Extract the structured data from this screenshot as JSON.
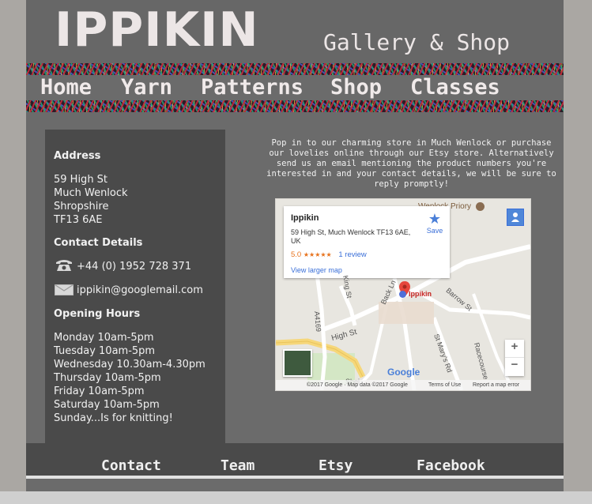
{
  "header": {
    "logo": "IPPIKIN",
    "tagline": "Gallery & Shop"
  },
  "nav": {
    "items": [
      {
        "label": "Home"
      },
      {
        "label": "Yarn"
      },
      {
        "label": "Patterns"
      },
      {
        "label": "Shop"
      },
      {
        "label": "Classes"
      }
    ]
  },
  "sidebar": {
    "address_heading": "Address",
    "address_lines": [
      "59 High St",
      "Much Wenlock",
      "Shropshire",
      "TF13 6AE"
    ],
    "contact_heading": "Contact Details",
    "phone": "+44 (0) 1952 728 371",
    "email": "ippikin@googlemail.com",
    "hours_heading": "Opening Hours",
    "hours": [
      "Monday 10am-5pm",
      "Tuesday 10am-5pm",
      "Wednesday 10.30am-4.30pm",
      "Thursday 10am-5pm",
      "Friday 10am-5pm",
      "Saturday 10am-5pm",
      "Sunday...Is for knitting!"
    ]
  },
  "main": {
    "intro": "Pop in to our charming store in Much Wenlock or purchase our lovelies online through our Etsy store. Alternatively send us an email mentioning the product numbers you're interested in and your contact details, we will be sure to reply promptly!"
  },
  "map": {
    "place_name": "Ippikin",
    "address": "59 High St, Much Wenlock TF13 6AE, UK",
    "rating": "5.0",
    "stars": "★★★★★",
    "reviews": "1 review",
    "save_label": "Save",
    "larger_map": "View larger map",
    "marker_label": "Ippikin",
    "poi_priory": "Wenlock Priory",
    "roads": [
      "High St",
      "Barrow St",
      "King St",
      "Back Ln",
      "St Mary's Rd",
      "Racecourse",
      "A4169",
      "Shei"
    ],
    "logo": "Google",
    "attribution": "©2017 Google · Map data ©2017 Google",
    "terms": "Terms of Use",
    "report": "Report a map error",
    "zoom_in": "+",
    "zoom_out": "−",
    "colors": {
      "road": "#ffffff",
      "main_road": "#f6d77a",
      "land": "#e8e6e0",
      "park": "#d4e7c5",
      "pin": "#e6463c",
      "label": "#c5221f",
      "star": "#e7711b",
      "link": "#3a6fd8"
    }
  },
  "footer": {
    "items": [
      {
        "label": "Contact"
      },
      {
        "label": "Team"
      },
      {
        "label": "Etsy"
      },
      {
        "label": "Facebook"
      }
    ]
  }
}
